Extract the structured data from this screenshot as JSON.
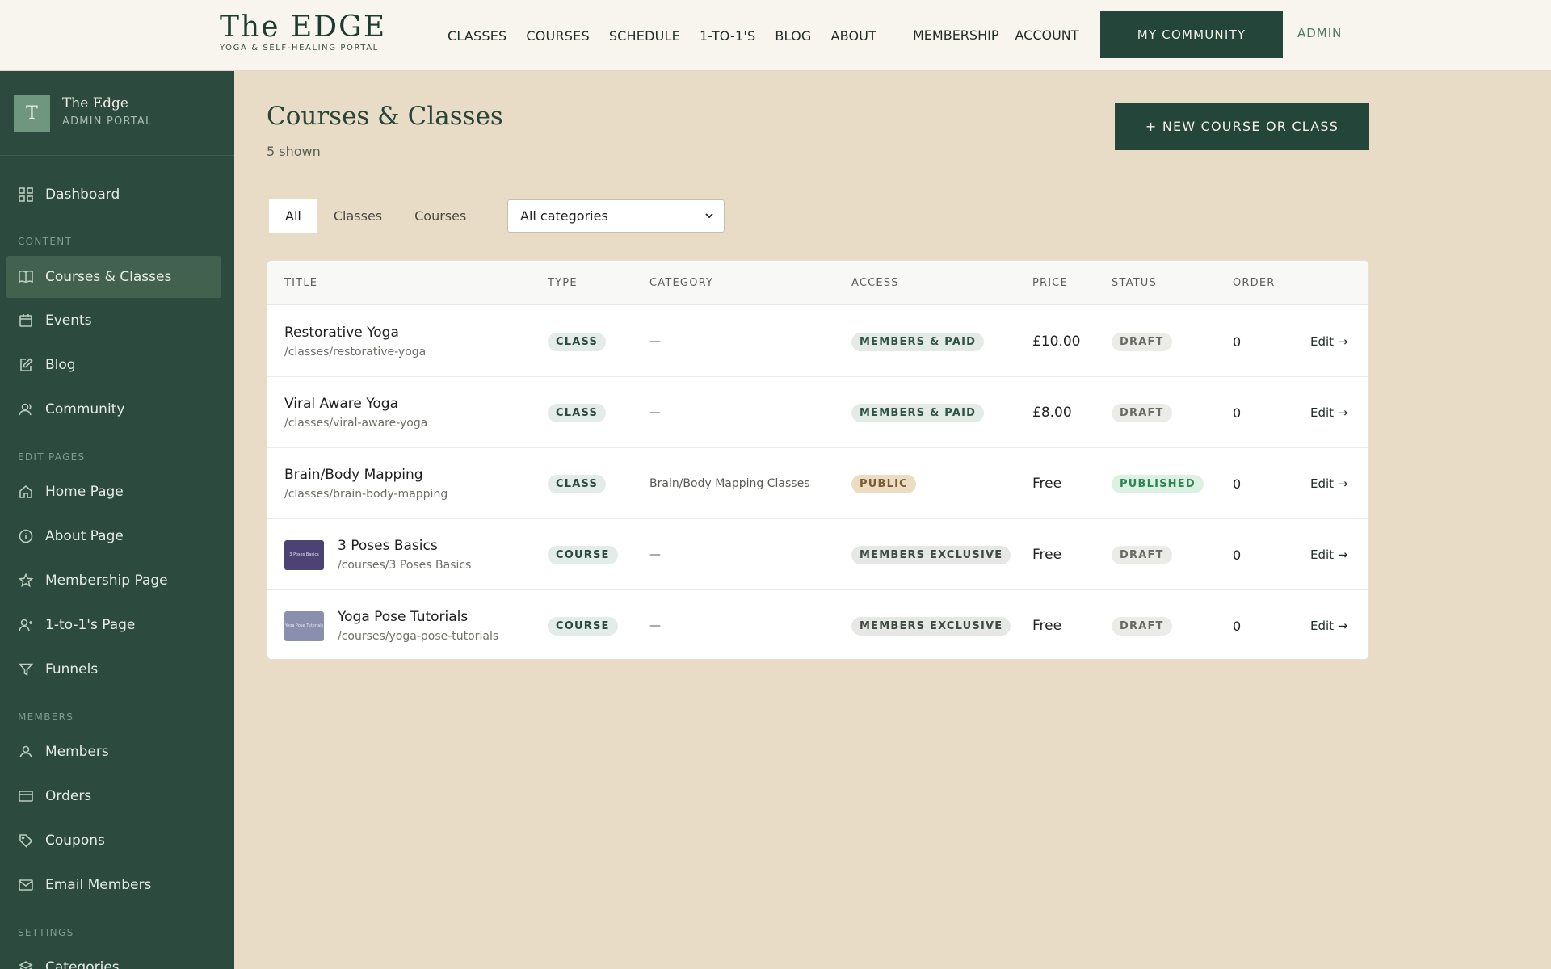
{
  "topnav": {
    "brand_title": "The EDGE",
    "brand_sub": "YOGA & SELF-HEALING PORTAL",
    "links": [
      "CLASSES",
      "COURSES",
      "SCHEDULE",
      "1-TO-1'S",
      "BLOG",
      "ABOUT"
    ],
    "links_right": [
      "MEMBERSHIP",
      "ACCOUNT"
    ],
    "community_button": "MY COMMUNITY",
    "admin_link": "ADMIN"
  },
  "sidebar": {
    "avatar_letter": "T",
    "name": "The Edge",
    "subtitle": "ADMIN PORTAL",
    "dashboard": "Dashboard",
    "section_content": "CONTENT",
    "content_items": [
      "Courses & Classes",
      "Events",
      "Blog",
      "Community"
    ],
    "section_edit": "EDIT PAGES",
    "edit_items": [
      "Home Page",
      "About Page",
      "Membership Page",
      "1-to-1's Page",
      "Funnels"
    ],
    "section_members": "MEMBERS",
    "member_items": [
      "Members",
      "Orders",
      "Coupons",
      "Email Members"
    ],
    "section_settings": "SETTINGS",
    "settings_items": [
      "Categories"
    ]
  },
  "main": {
    "title": "Courses & Classes",
    "count": "5 shown",
    "new_button": "+ NEW COURSE OR CLASS",
    "filter_tabs": [
      "All",
      "Classes",
      "Courses"
    ],
    "category_select": "All categories"
  },
  "table": {
    "headers": [
      "TITLE",
      "TYPE",
      "CATEGORY",
      "ACCESS",
      "PRICE",
      "STATUS",
      "ORDER"
    ],
    "rows": [
      {
        "title": "Restorative Yoga",
        "slug": "/classes/restorative-yoga",
        "type": "CLASS",
        "category": "—",
        "access": "MEMBERS & PAID",
        "price": "£10.00",
        "status": "DRAFT",
        "order": "0",
        "edit": "Edit →"
      },
      {
        "title": "Viral Aware Yoga",
        "slug": "/classes/viral-aware-yoga",
        "type": "CLASS",
        "category": "—",
        "access": "MEMBERS & PAID",
        "price": "£8.00",
        "status": "DRAFT",
        "order": "0",
        "edit": "Edit →"
      },
      {
        "title": "Brain/Body Mapping",
        "slug": "/classes/brain-body-mapping",
        "type": "CLASS",
        "category": "Brain/Body Mapping Classes",
        "access": "PUBLIC",
        "price": "Free",
        "status": "PUBLISHED",
        "order": "0",
        "edit": "Edit →"
      },
      {
        "title": "3 Poses Basics",
        "slug": "/courses/3 Poses Basics",
        "type": "COURSE",
        "category": "—",
        "access": "MEMBERS EXCLUSIVE",
        "price": "Free",
        "status": "DRAFT",
        "order": "0",
        "edit": "Edit →",
        "thumb_text": "3 Poses Basics"
      },
      {
        "title": "Yoga Pose Tutorials",
        "slug": "/courses/yoga-pose-tutorials",
        "type": "COURSE",
        "category": "—",
        "access": "MEMBERS EXCLUSIVE",
        "price": "Free",
        "status": "DRAFT",
        "order": "0",
        "edit": "Edit →",
        "thumb_text": "Yoga Pose Tutorials"
      }
    ]
  },
  "colors": {
    "sidebar_bg": "#2d4a3e",
    "accent": "#24463a",
    "page_bg": "#e8dcc7",
    "published": "#2d8653"
  }
}
